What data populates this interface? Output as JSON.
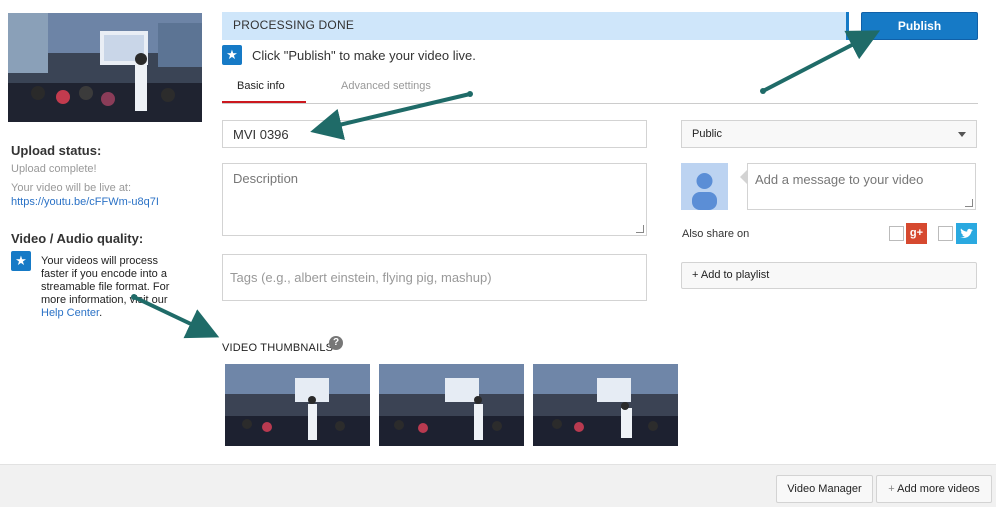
{
  "left": {
    "upload_status_heading": "Upload status:",
    "upload_complete": "Upload complete!",
    "live_at_label": "Your video will be live at:",
    "video_url": "https://youtu.be/cFFWm-u8q7I",
    "quality_heading": "Video / Audio quality:",
    "quality_text": "Your videos will process faster if you encode into a streamable file format. For more information, visit our",
    "help_center_link": "Help Center",
    "help_center_suffix": "."
  },
  "status_bar": {
    "text": "PROCESSING DONE",
    "publish_label": "Publish"
  },
  "info": {
    "text": "Click \"Publish\" to make your video live."
  },
  "tabs": [
    {
      "label": "Basic info",
      "active": true
    },
    {
      "label": "Advanced settings",
      "active": false
    }
  ],
  "form": {
    "title_value": "MVI 0396",
    "description_placeholder": "Description",
    "tags_placeholder": "Tags (e.g., albert einstein, flying pig, mashup)"
  },
  "right": {
    "privacy_value": "Public",
    "message_placeholder": "Add a message to your video",
    "share_label": "Also share on",
    "gplus_glyph": "g+",
    "add_to_playlist": "+ Add to playlist"
  },
  "thumbnails": {
    "label": "VIDEO THUMBNAILS",
    "help_glyph": "?"
  },
  "footer": {
    "video_manager": "Video Manager",
    "add_more_videos": "Add more videos"
  },
  "colors": {
    "accent_blue": "#167ac6",
    "processing_bar": "#cfe6fa",
    "tab_underline": "#cc181e",
    "annotation_arrow": "#1f6b68"
  }
}
